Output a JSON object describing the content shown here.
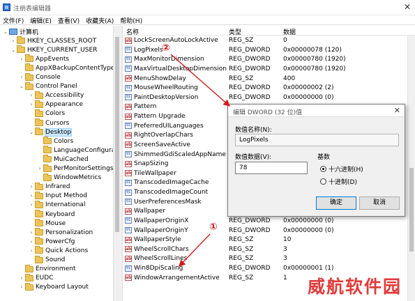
{
  "window": {
    "title": "注册表编辑器",
    "close": "✕"
  },
  "menu": [
    "文件(F)",
    "编辑(E)",
    "查看(V)",
    "收藏夹(A)",
    "帮助(H)"
  ],
  "tree": [
    {
      "label": "计算机",
      "depth": 0,
      "exp": "⌄",
      "icon": "computer-icon"
    },
    {
      "label": "HKEY_CLASSES_ROOT",
      "depth": 1,
      "exp": "›",
      "icon": "folder-icon"
    },
    {
      "label": "HKEY_CURRENT_USER",
      "depth": 1,
      "exp": "⌄",
      "icon": "folder-icon"
    },
    {
      "label": "AppEvents",
      "depth": 2,
      "exp": "›",
      "icon": "folder-icon"
    },
    {
      "label": "AppXBackupContentType",
      "depth": 2,
      "exp": "",
      "icon": "folder-icon"
    },
    {
      "label": "Console",
      "depth": 2,
      "exp": "›",
      "icon": "folder-icon"
    },
    {
      "label": "Control Panel",
      "depth": 2,
      "exp": "⌄",
      "icon": "folder-icon"
    },
    {
      "label": "Accessibility",
      "depth": 3,
      "exp": "›",
      "icon": "folder-icon"
    },
    {
      "label": "Appearance",
      "depth": 3,
      "exp": "›",
      "icon": "folder-icon"
    },
    {
      "label": "Colors",
      "depth": 3,
      "exp": "",
      "icon": "folder-icon"
    },
    {
      "label": "Cursors",
      "depth": 3,
      "exp": "",
      "icon": "folder-icon"
    },
    {
      "label": "Desktop",
      "depth": 3,
      "exp": "⌄",
      "icon": "folder-icon",
      "selected": true
    },
    {
      "label": "Colors",
      "depth": 4,
      "exp": "",
      "icon": "folder-icon"
    },
    {
      "label": "LanguageConfiguratio",
      "depth": 4,
      "exp": "",
      "icon": "folder-icon"
    },
    {
      "label": "MuiCached",
      "depth": 4,
      "exp": "",
      "icon": "folder-icon"
    },
    {
      "label": "PerMonitorSettings",
      "depth": 4,
      "exp": "›",
      "icon": "folder-icon"
    },
    {
      "label": "WindowMetrics",
      "depth": 4,
      "exp": "",
      "icon": "folder-icon"
    },
    {
      "label": "Infrared",
      "depth": 3,
      "exp": "›",
      "icon": "folder-icon"
    },
    {
      "label": "Input Method",
      "depth": 3,
      "exp": "›",
      "icon": "folder-icon"
    },
    {
      "label": "International",
      "depth": 3,
      "exp": "›",
      "icon": "folder-icon"
    },
    {
      "label": "Keyboard",
      "depth": 3,
      "exp": "",
      "icon": "folder-icon"
    },
    {
      "label": "Mouse",
      "depth": 3,
      "exp": "",
      "icon": "folder-icon"
    },
    {
      "label": "Personalization",
      "depth": 3,
      "exp": "›",
      "icon": "folder-icon"
    },
    {
      "label": "PowerCfg",
      "depth": 3,
      "exp": "›",
      "icon": "folder-icon"
    },
    {
      "label": "Quick Actions",
      "depth": 3,
      "exp": "›",
      "icon": "folder-icon"
    },
    {
      "label": "Sound",
      "depth": 3,
      "exp": "",
      "icon": "folder-icon"
    },
    {
      "label": "Environment",
      "depth": 2,
      "exp": "",
      "icon": "folder-icon"
    },
    {
      "label": "EUDC",
      "depth": 2,
      "exp": "›",
      "icon": "folder-icon"
    },
    {
      "label": "Keyboard Layout",
      "depth": 2,
      "exp": "›",
      "icon": "folder-icon"
    }
  ],
  "list": {
    "headers": {
      "name": "名称",
      "type": "类型",
      "data": "数据"
    },
    "rows": [
      {
        "name": "LockScreenAutoLockActive",
        "type": "REG_SZ",
        "data": "0",
        "icon": "string-value-icon"
      },
      {
        "name": "LogPixels",
        "type": "REG_DWORD",
        "data": "0x00000078 (120)",
        "icon": "binary-value-icon"
      },
      {
        "name": "MaxMonitorDimension",
        "type": "REG_DWORD",
        "data": "0x00000780 (1920)",
        "icon": "binary-value-icon"
      },
      {
        "name": "MaxVirtualDesktopDimension",
        "type": "REG_DWORD",
        "data": "0x00000780 (1920)",
        "icon": "binary-value-icon"
      },
      {
        "name": "MenuShowDelay",
        "type": "REG_SZ",
        "data": "400",
        "icon": "string-value-icon"
      },
      {
        "name": "MouseWheelRouting",
        "type": "REG_DWORD",
        "data": "0x00000002 (2)",
        "icon": "binary-value-icon"
      },
      {
        "name": "PaintDesktopVersion",
        "type": "REG_DWORD",
        "data": "0x00000000 (0)",
        "icon": "binary-value-icon"
      },
      {
        "name": "Pattern",
        "type": "",
        "data": "",
        "icon": "string-value-icon"
      },
      {
        "name": "Pattern Upgrade",
        "type": "",
        "data": "",
        "icon": "string-value-icon"
      },
      {
        "name": "PreferredUILanguages",
        "type": "",
        "data": "",
        "icon": "binary-value-icon"
      },
      {
        "name": "RightOverlapChars",
        "type": "",
        "data": "",
        "icon": "string-value-icon"
      },
      {
        "name": "ScreenSaveActive",
        "type": "",
        "data": "",
        "icon": "string-value-icon"
      },
      {
        "name": "ShimmedGdiScaledAppName",
        "type": "",
        "data": "",
        "icon": "binary-value-icon"
      },
      {
        "name": "SnapSizing",
        "type": "",
        "data": "",
        "icon": "string-value-icon"
      },
      {
        "name": "TileWallpaper",
        "type": "",
        "data": "",
        "icon": "string-value-icon"
      },
      {
        "name": "TranscodedImageCache",
        "type": "",
        "data": "",
        "icon": "binary-value-icon"
      },
      {
        "name": "TranscodedImageCount",
        "type": "",
        "data": "",
        "icon": "binary-value-icon"
      },
      {
        "name": "UserPreferencesMask",
        "type": "",
        "data": "",
        "icon": "binary-value-icon"
      },
      {
        "name": "Wallpaper",
        "type": "",
        "data": "",
        "icon": "string-value-icon"
      },
      {
        "name": "WallpaperOriginX",
        "type": "REG_DWORD",
        "data": "0x00000000 (0)",
        "icon": "binary-value-icon"
      },
      {
        "name": "WallpaperOriginY",
        "type": "REG_DWORD",
        "data": "0x00000000 (0)",
        "icon": "binary-value-icon"
      },
      {
        "name": "WallpaperStyle",
        "type": "REG_SZ",
        "data": "10",
        "icon": "string-value-icon"
      },
      {
        "name": "WheelScrollChars",
        "type": "REG_SZ",
        "data": "3",
        "icon": "string-value-icon"
      },
      {
        "name": "WheelScrollLines",
        "type": "REG_SZ",
        "data": "3",
        "icon": "string-value-icon"
      },
      {
        "name": "Win8DpiScaling",
        "type": "REG_DWORD",
        "data": "0x00000001 (1)",
        "icon": "binary-value-icon"
      },
      {
        "name": "WindowArrangementActive",
        "type": "REG_SZ",
        "data": "1",
        "icon": "string-value-icon"
      }
    ]
  },
  "dialog": {
    "title": "编辑 DWORD (32 位)值",
    "close": "✕",
    "name_label": "数值名称(N):",
    "name_value": "LogPixels",
    "data_label": "数值数据(V):",
    "data_value": "78",
    "base_label": "基数",
    "hex_label": "十六进制(H)",
    "dec_label": "十进制(D)",
    "base_selected": "hex",
    "ok": "确定",
    "cancel": "取消"
  },
  "annotations": {
    "one": "①",
    "two": "②",
    "color": "#d41c1c"
  },
  "watermark": "威航软件园"
}
